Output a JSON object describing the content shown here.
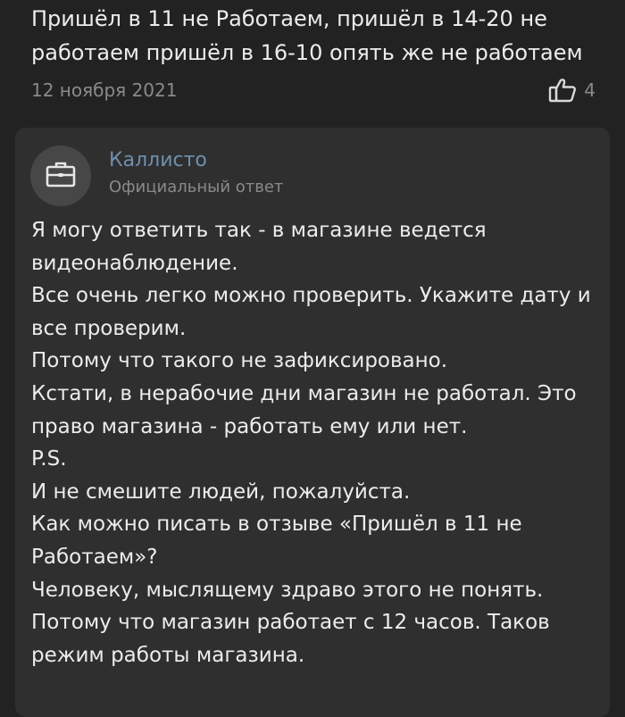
{
  "review": {
    "text": "Пришёл в 11 не Работаем, пришёл в 14-20 не работаем пришёл в 16-10 опять же не работаем",
    "date": "12 ноября 2021",
    "likes": "4",
    "like_icon": "thumbs-up-icon"
  },
  "official_answer": {
    "avatar_icon": "briefcase-icon",
    "author": "Каллисто",
    "role": "Официальный ответ",
    "lines": [
      "Я могу ответить так - в магазине ведется",
      "видеонаблюдение.",
      "Все очень легко можно проверить. Укажите дату и",
      "все проверим.",
      "Потому что такого не зафиксировано.",
      "Кстати, в нерабочие дни магазин не работал. Это",
      "право магазина - работать ему или нет.",
      "P.S.",
      "И не смешите людей, пожалуйста.",
      "Как можно писать в отзыве «Пришёл в 11 не",
      "Работаем»?",
      "Человеку, мыслящему здраво этого не понять.",
      "Потому что магазин работает с 12 часов. Таков",
      "режим работы магазина."
    ]
  },
  "colors": {
    "background": "#222222",
    "card": "#2f2f2f",
    "text": "#ececec",
    "muted": "#8a8a8a",
    "author": "#6f8fae"
  }
}
